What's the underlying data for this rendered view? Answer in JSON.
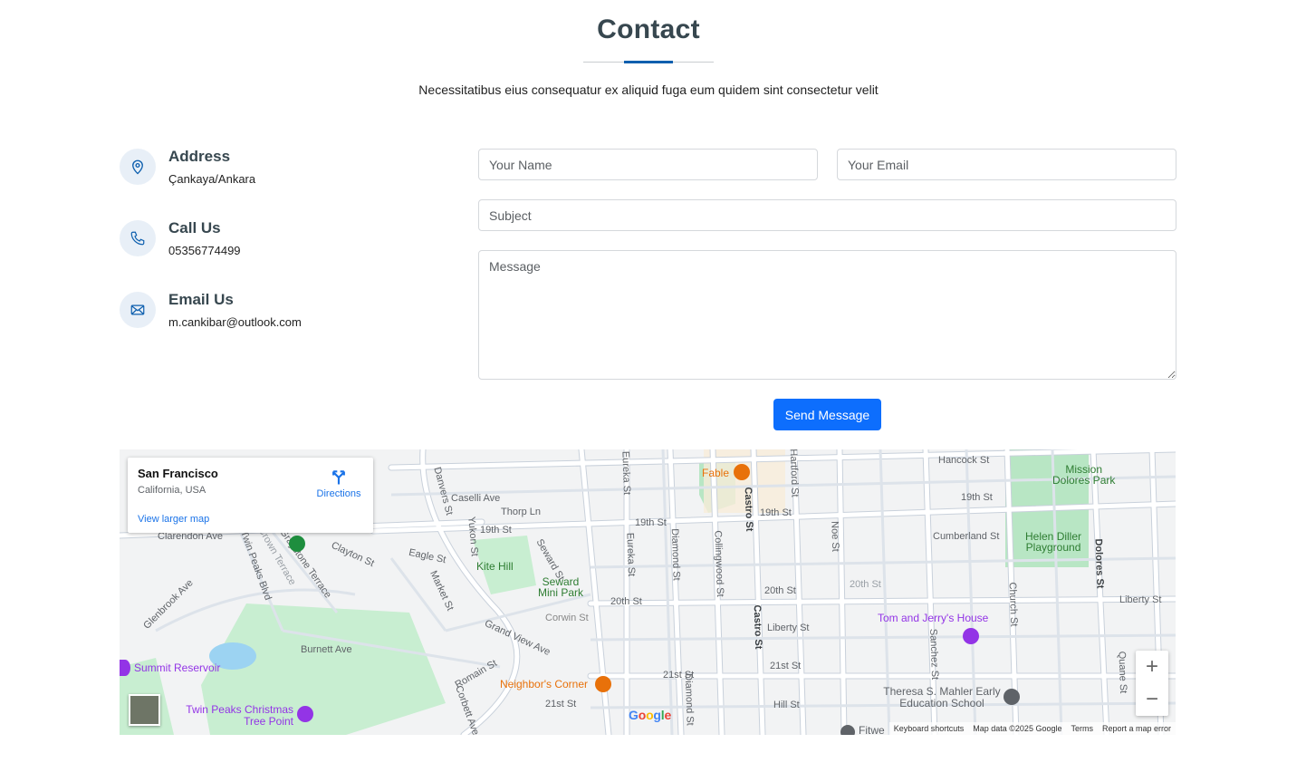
{
  "header": {
    "title": "Contact",
    "subtitle": "Necessitatibus eius consequatur ex aliquid fuga eum quidem sint consectetur velit"
  },
  "info": {
    "address": {
      "icon": "map-pin-icon",
      "title": "Address",
      "text": "Çankaya/Ankara"
    },
    "call": {
      "icon": "phone-icon",
      "title": "Call Us",
      "text": "05356774499"
    },
    "email": {
      "icon": "envelope-icon",
      "title": "Email Us",
      "text": "m.cankibar@outlook.com"
    }
  },
  "form": {
    "name_placeholder": "Your Name",
    "email_placeholder": "Your Email",
    "subject_placeholder": "Subject",
    "message_placeholder": "Message",
    "submit_label": "Send Message"
  },
  "map": {
    "place_name": "San Francisco",
    "place_region": "California, USA",
    "directions_label": "Directions",
    "larger_map_label": "View larger map",
    "zoom_in": "+",
    "zoom_out": "−",
    "google": "Google",
    "attribution": [
      "Keyboard shortcuts",
      "Map data ©2025 Google",
      "Terms",
      "Report a map error"
    ],
    "streets": [
      "Hancock St",
      "19th St",
      "Caselli Ave",
      "Thorp Ln",
      "19th St",
      "19th St",
      "Cumberland St",
      "Clarendon Ave",
      "Clayton St",
      "Eagle St",
      "Kite Hill",
      "Seward St",
      "20th St",
      "20th St",
      "20th St",
      "Liberty St",
      "Liberty St",
      "Corwin St",
      "Grand View Ave",
      "Burnett Ave",
      "Glenbrook Ave",
      "Twin Peaks Blvd",
      "Graystone Terrace",
      "Crown Terrace",
      "Market St",
      "Danvers St",
      "Yukon St",
      "Eureka St",
      "Eureka St",
      "Diamond St",
      "Diamond St",
      "Collingwood St",
      "Castro St",
      "Castro St",
      "Hartford St",
      "Noe St",
      "Sanchez St",
      "Church St",
      "Dolores St",
      "Mission Dolores Park",
      "Helen Diller Playground",
      "21st St",
      "21st St",
      "21st St",
      "Hill St",
      "Romain St",
      "Corbett Ave",
      "Quane St",
      "Mission",
      "Seward Mini Park"
    ],
    "pois": {
      "fable": "Fable",
      "summit": "Summit Reservoir",
      "twin_peaks": "Twin Peaks Christmas Tree Point",
      "tom_jerry": "Tom and Jerry's House",
      "neighbors": "Neighbor's Corner",
      "theresa": "Theresa S. Mahler Early Education School",
      "fitwell": "Fitwe"
    },
    "colors": {
      "park": "#b8e6c4",
      "road": "#ffffff",
      "road_edge": "#c9d1db",
      "poi_purple": "#9334e6",
      "poi_orange": "#e8710a",
      "water": "#9cd3f2"
    }
  },
  "colors": {
    "accent": "#0d5fae",
    "button": "#0d6efd",
    "icon_bg": "#e8eff7"
  }
}
